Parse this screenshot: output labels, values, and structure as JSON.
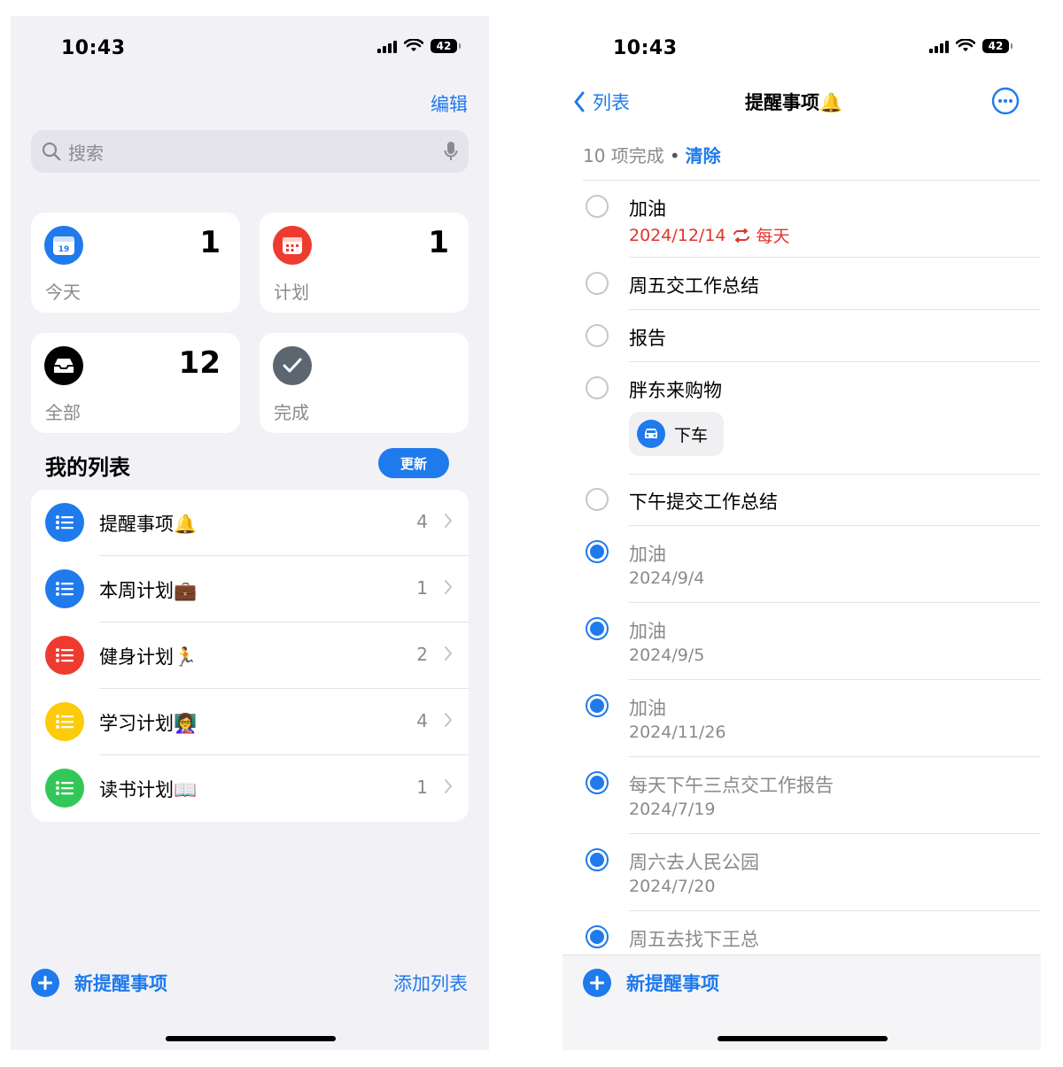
{
  "left_screen": {
    "status_time": "10:43",
    "battery": "42",
    "edit_label": "编辑",
    "search_placeholder": "搜索",
    "cards": {
      "today": {
        "label": "今天",
        "count": "1",
        "icon_text": "19"
      },
      "scheduled": {
        "label": "计划",
        "count": "1"
      },
      "all": {
        "label": "全部",
        "count": "12"
      },
      "completed": {
        "label": "完成"
      }
    },
    "section_title": "我的列表",
    "update_button": "更新",
    "lists": [
      {
        "name": "提醒事项🔔",
        "count": "4",
        "color": "#1f7aec"
      },
      {
        "name": "本周计划💼",
        "count": "1",
        "color": "#1f7aec"
      },
      {
        "name": "健身计划🏃",
        "count": "2",
        "color": "#ee3b30"
      },
      {
        "name": "学习计划👩‍🏫",
        "count": "4",
        "color": "#fccb0a"
      },
      {
        "name": "读书计划📖",
        "count": "1",
        "color": "#33c759"
      }
    ],
    "new_reminder": "新提醒事项",
    "add_list": "添加列表"
  },
  "right_screen": {
    "status_time": "10:43",
    "battery": "42",
    "back_label": "列表",
    "title": "提醒事项🔔",
    "summary_count": "10 项完成",
    "summary_dot": "•",
    "clear_label": "清除",
    "reminders": [
      {
        "title": "加油",
        "date": "2024/12/14",
        "repeat": "每天",
        "done": false
      },
      {
        "title": "周五交工作总结",
        "done": false
      },
      {
        "title": "报告",
        "done": false
      },
      {
        "title": "胖东来购物",
        "chip": "下车",
        "done": false
      },
      {
        "title": "下午提交工作总结",
        "done": false
      },
      {
        "title": "加油",
        "date": "2024/9/4",
        "done": true
      },
      {
        "title": "加油",
        "date": "2024/9/5",
        "done": true
      },
      {
        "title": "加油",
        "date": "2024/11/26",
        "done": true
      },
      {
        "title": "每天下午三点交工作报告",
        "date": "2024/7/19",
        "done": true
      },
      {
        "title": "周六去人民公园",
        "date": "2024/7/20",
        "done": true
      },
      {
        "title": "周五去找下王总",
        "done": true
      }
    ],
    "new_reminder": "新提醒事项"
  },
  "colors": {
    "accent": "#1f7aec",
    "red": "#e0352b",
    "gray_text": "#8a8a8e",
    "background": "#f2f2f6"
  }
}
